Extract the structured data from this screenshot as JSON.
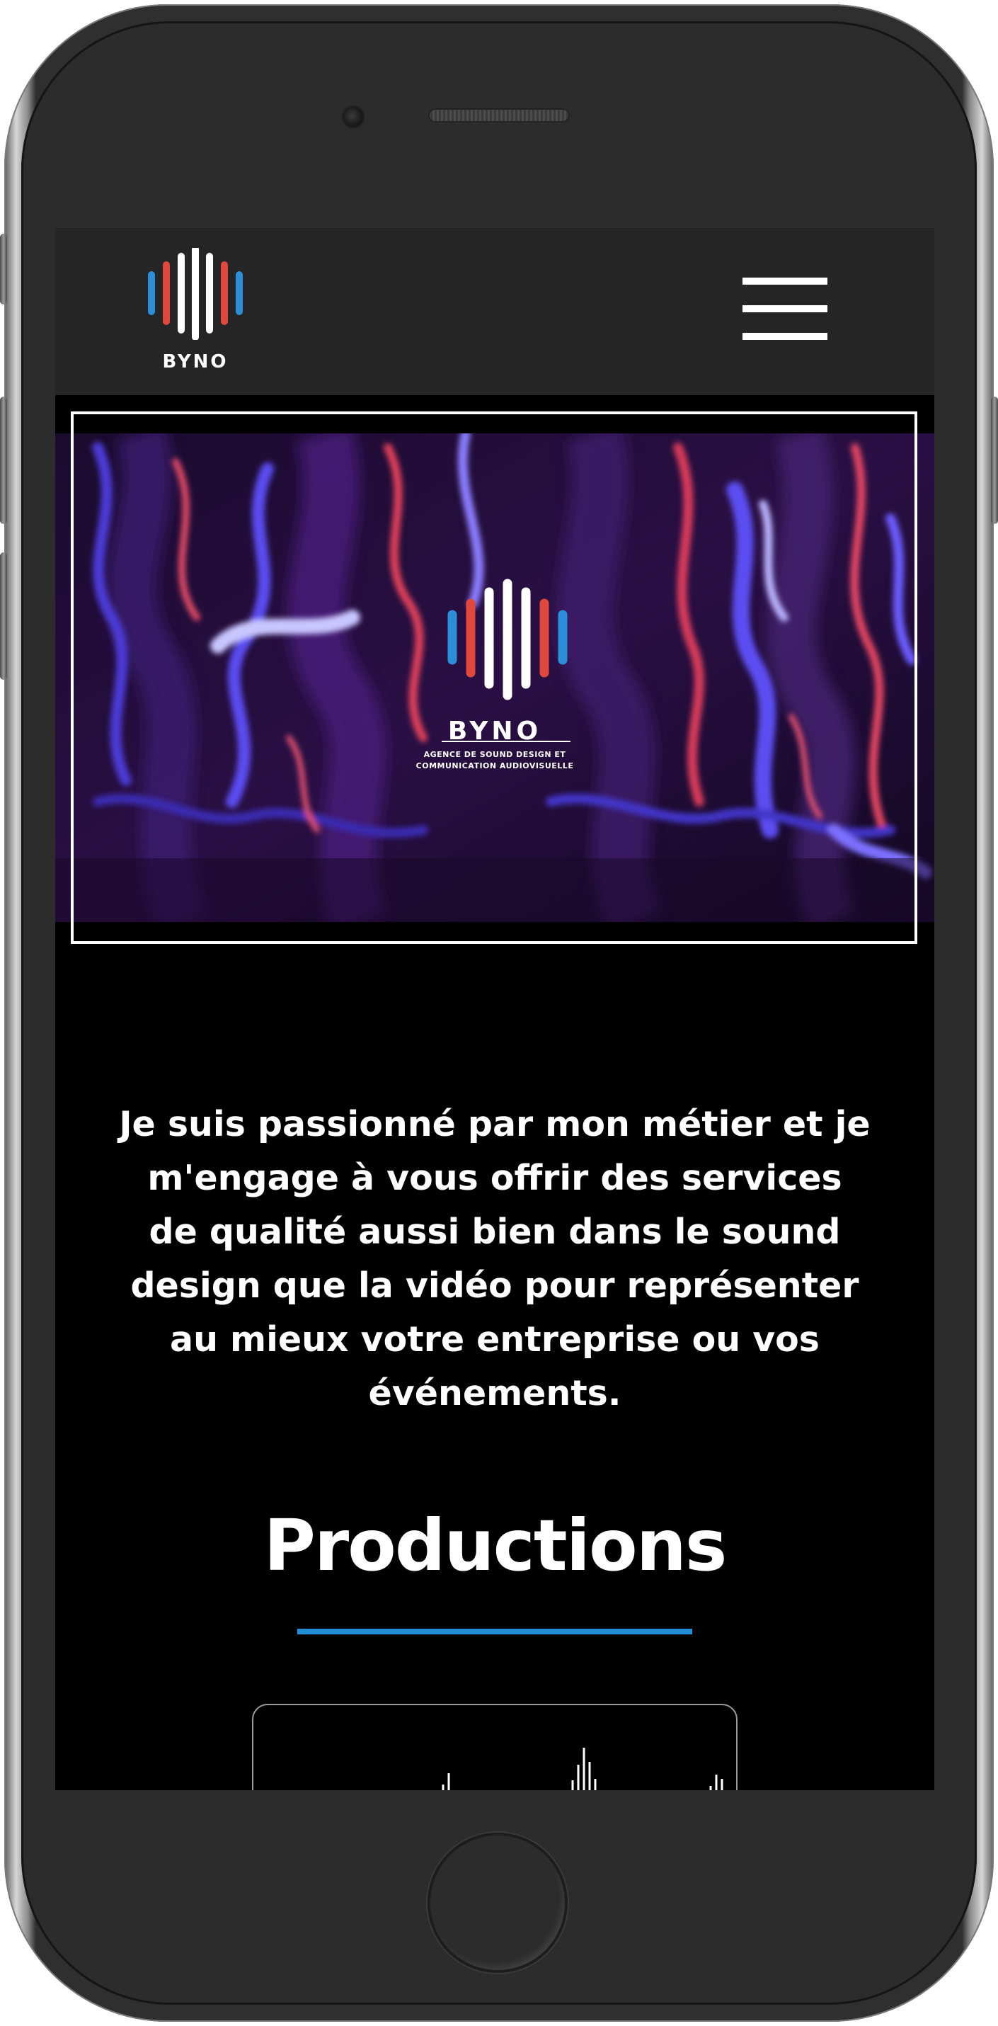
{
  "header": {
    "logo_text": "BYNO",
    "menu_icon": "hamburger-menu-icon"
  },
  "hero": {
    "logo_text": "BYNO",
    "tagline_line1": "AGENCE DE SOUND DESIGN ET",
    "tagline_line2": "COMMUNICATION AUDIOVISUELLE"
  },
  "intro": {
    "text": "Je suis passionné par mon métier et je m'engage à vous offrir des services de qualité aussi bien dans le sound design que la vidéo pour représenter au mieux votre entreprise ou vos événements."
  },
  "productions": {
    "title": "Productions"
  },
  "colors": {
    "header_bg": "#252525",
    "page_bg": "#000000",
    "accent_blue": "#1e8fd6",
    "logo_red": "#e0483e",
    "logo_blue": "#2a8fd8"
  }
}
